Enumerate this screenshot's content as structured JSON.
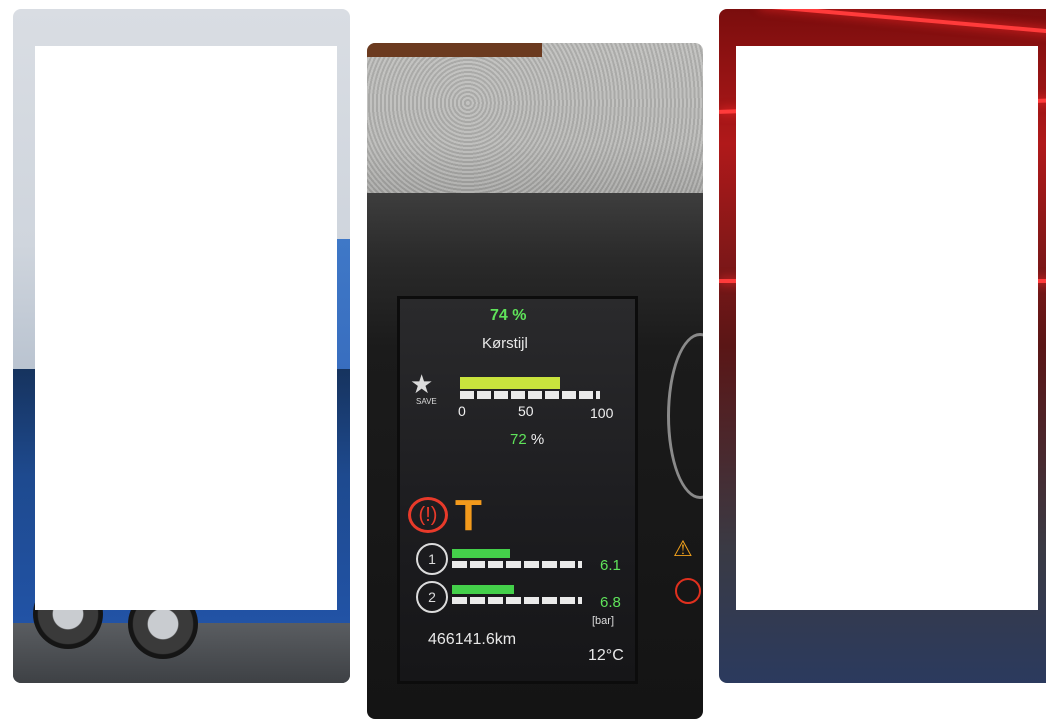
{
  "center_photo": {
    "range_percent": "74 %",
    "screen_title": "Kørstijl",
    "gauge_ticks": [
      "0",
      "50",
      "100"
    ],
    "gauge_reading_value": "72",
    "gauge_reading_unit": "%",
    "star_label": "SAVE",
    "brake_symbol": "(!)",
    "trailer_symbol": "T",
    "circuit_1": "1",
    "circuit_2": "2",
    "pressure_1": "6.1",
    "pressure_2": "6.8",
    "pressure_unit": "[bar]",
    "odometer": "466141.6km",
    "temperature": "12°C",
    "warning_symbol": "⚠"
  },
  "colors": {
    "display_green": "#5fe35a",
    "brake_red": "#e83a2a",
    "trailer_orange": "#f39a1c"
  }
}
